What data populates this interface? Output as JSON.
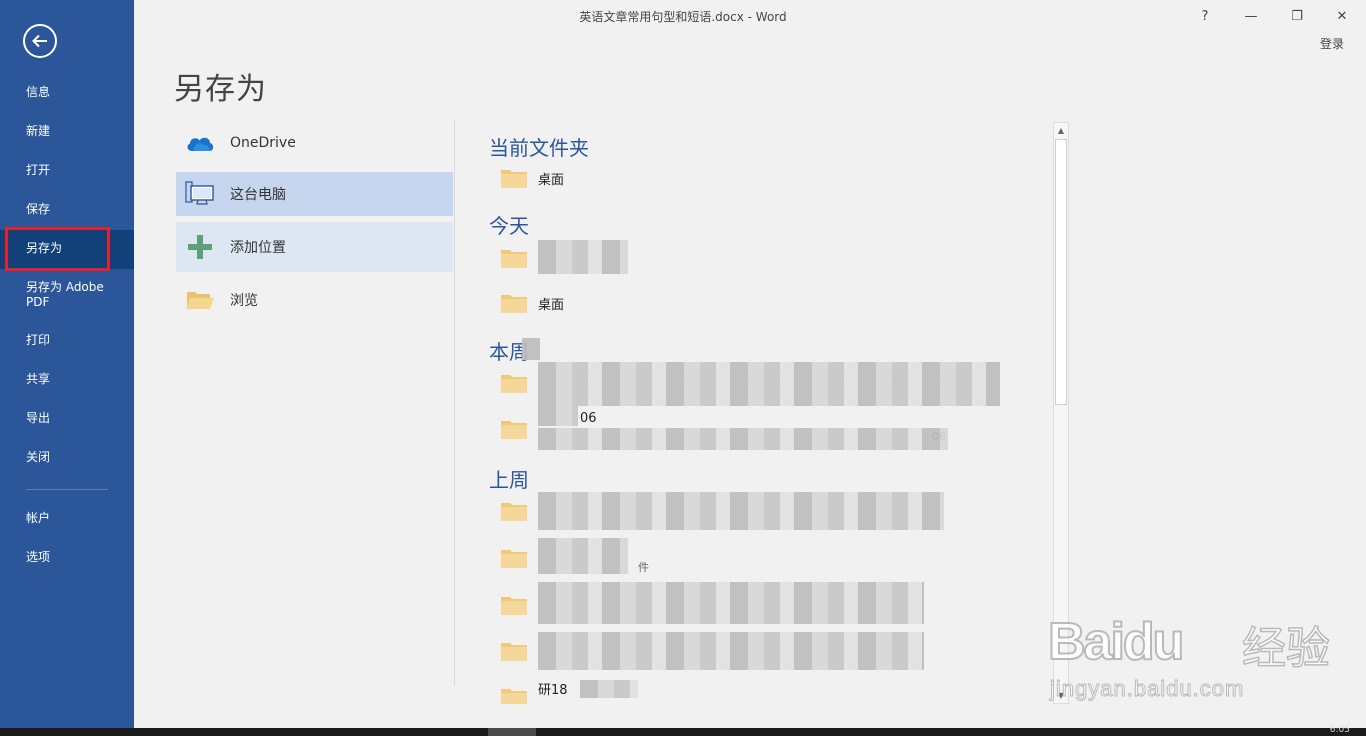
{
  "window": {
    "title": "英语文章常用句型和短语.docx - Word",
    "help_glyph": "?",
    "minimize_glyph": "—",
    "restore_glyph": "❐",
    "close_glyph": "✕",
    "login_label": "登录"
  },
  "sidebar": {
    "items": [
      {
        "label": "信息"
      },
      {
        "label": "新建"
      },
      {
        "label": "打开"
      },
      {
        "label": "保存"
      },
      {
        "label": "另存为",
        "active": true
      },
      {
        "label": "另存为 Adobe PDF"
      },
      {
        "label": "打印"
      },
      {
        "label": "共享"
      },
      {
        "label": "导出"
      },
      {
        "label": "关闭"
      },
      {
        "label": "帐户"
      },
      {
        "label": "选项"
      }
    ],
    "accent_color": "#2b579a",
    "highlight_color": "#e8202a"
  },
  "page": {
    "heading": "另存为"
  },
  "locations": [
    {
      "label": "OneDrive",
      "icon": "onedrive-cloud-icon"
    },
    {
      "label": "这台电脑",
      "icon": "computer-icon",
      "selected": true
    },
    {
      "label": "添加位置",
      "icon": "plus-icon"
    },
    {
      "label": "浏览",
      "icon": "folder-open-icon"
    }
  ],
  "recent": {
    "groups": [
      {
        "title": "当前文件夹",
        "folders": [
          {
            "name": "桌面"
          }
        ]
      },
      {
        "title": "今天",
        "folders": [
          {
            "name": ""
          },
          {
            "name": "桌面"
          }
        ]
      },
      {
        "title": "本周",
        "folders": [
          {
            "name": ""
          },
          {
            "name": "06",
            "path": "06"
          }
        ]
      },
      {
        "title": "上周",
        "folders": [
          {
            "name": ""
          },
          {
            "name": "",
            "path": "件"
          },
          {
            "name": ""
          },
          {
            "name": ""
          },
          {
            "name": "研18"
          }
        ]
      }
    ]
  },
  "watermark": {
    "brand": "Baidu",
    "brand_suffix": "经验",
    "url": "jingyan.baidu.com"
  },
  "taskbar": {
    "clock": "6:05"
  }
}
